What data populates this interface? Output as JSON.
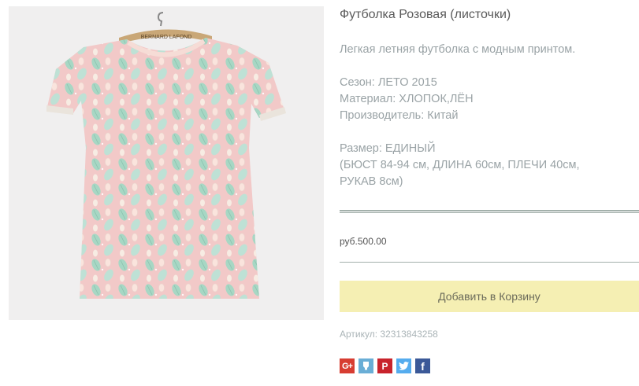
{
  "product": {
    "image_label": "BERNARD LAFOND",
    "title": "Футболка Розовая (листочки)",
    "description": {
      "tagline": "Легкая летняя футболка с модным принтом.",
      "season": "Сезон: ЛЕТО 2015",
      "material": "Материал: ХЛОПОК,ЛЁН",
      "manufacturer": "Производитель: Китай",
      "size": "Размер: ЕДИНЫЙ",
      "measurements_line1": "(БЮСТ 84-94 см, ДЛИНА 60см, ПЛЕЧИ 40см,",
      "measurements_line2": "РУКАВ 8см)"
    },
    "price": "руб.500.00",
    "add_to_cart_label": "Добавить в Корзину",
    "sku": "Артикул: 32313843258"
  },
  "share": {
    "gplus": "G+",
    "pinterest": "P",
    "facebook": "f"
  },
  "colors": {
    "cart_button": "#f5efb3",
    "shirt_pink": "#f2c9c8",
    "leaf_mint": "#9fd8c4"
  }
}
